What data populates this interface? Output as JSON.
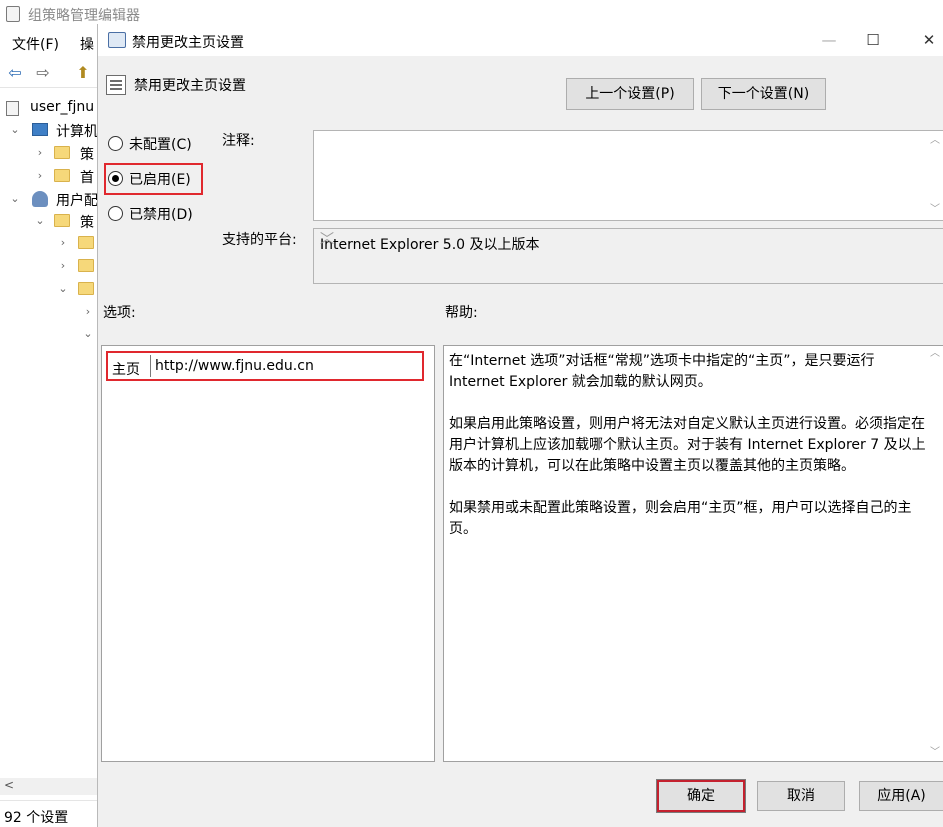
{
  "background_window": {
    "title": "组策略管理编辑器",
    "menu": [
      "文件(F)",
      "操"
    ],
    "tree": [
      {
        "label": "user_fjnu",
        "chevron": ""
      },
      {
        "label": "计算机",
        "chevron": "⌄"
      },
      {
        "label": "策",
        "chevron": "›"
      },
      {
        "label": "首",
        "chevron": "›"
      },
      {
        "label": "用户配",
        "chevron": "⌄"
      },
      {
        "label": "策",
        "chevron": "⌄"
      },
      {
        "label": "",
        "chevron": "›"
      },
      {
        "label": "",
        "chevron": "›"
      },
      {
        "label": "",
        "chevron": "⌄"
      },
      {
        "label": "",
        "chevron": "›"
      },
      {
        "label": "",
        "chevron": "⌄"
      }
    ],
    "scroll_left": "<",
    "status": "92 个设置"
  },
  "dialog": {
    "title": "禁用更改主页设置",
    "window_buttons": {
      "minimize": "—",
      "maximize": "☐",
      "close": "✕"
    },
    "header_title": "禁用更改主页设置",
    "prev_button": "上一个设置(P)",
    "next_button": "下一个设置(N)",
    "radios": [
      {
        "label": "未配置(C)",
        "selected": false
      },
      {
        "label": "已启用(E)",
        "selected": true
      },
      {
        "label": "已禁用(D)",
        "selected": false
      }
    ],
    "comment_label": "注释:",
    "comment_value": "",
    "platform_label": "支持的平台:",
    "platform_value": "Internet Explorer 5.0 及以上版本",
    "options_label": "选项:",
    "help_label": "帮助:",
    "option_name": "主页",
    "option_value": "http://www.fjnu.edu.cn",
    "help_paragraphs": [
      "在“Internet 选项”对话框“常规”选项卡中指定的“主页”，是只要运行 Internet Explorer 就会加载的默认网页。",
      "如果启用此策略设置，则用户将无法对自定义默认主页进行设置。必须指定在用户计算机上应该加载哪个默认主页。对于装有 Internet Explorer 7 及以上版本的计算机，可以在此策略中设置主页以覆盖其他的主页策略。",
      "如果禁用或未配置此策略设置，则会启用“主页”框，用户可以选择自己的主页。"
    ],
    "ok_button": "确定",
    "cancel_button": "取消",
    "apply_button": "应用(A)"
  },
  "colors": {
    "highlight": "#e0282e",
    "dialog_bg": "#f0f0f0",
    "button_bg": "#e1e1e1"
  }
}
